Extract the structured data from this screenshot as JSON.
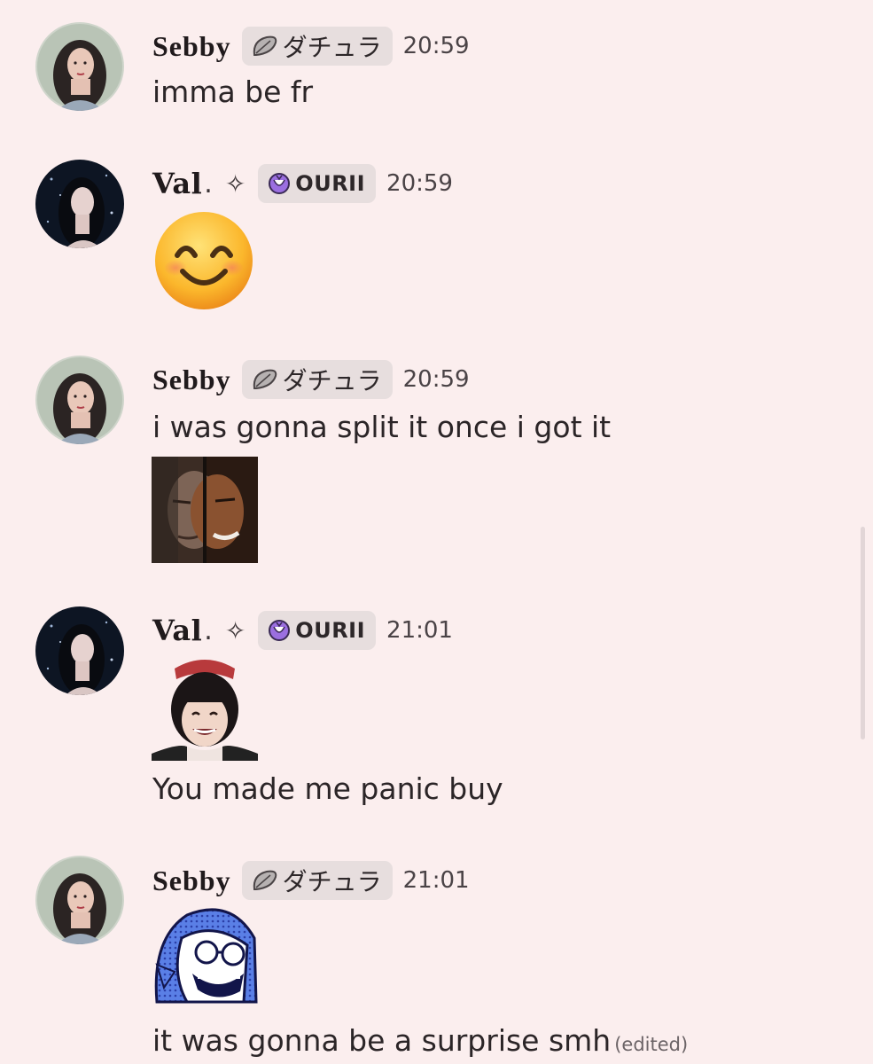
{
  "messages": [
    {
      "user": "Sebby",
      "tag": "ダチュラ",
      "time": "20:59",
      "text": "imma be fr"
    },
    {
      "user": "Val",
      "user_suffix": ".",
      "sparkle": "✧",
      "tag": "OURII",
      "time": "20:59",
      "emoji_icon": "smiling-face-emoji"
    },
    {
      "user": "Sebby",
      "tag": "ダチュラ",
      "time": "20:59",
      "text": "i was gonna split it once i got it",
      "attachment_icon": "split-face-sticker"
    },
    {
      "user": "Val",
      "user_suffix": ".",
      "sparkle": "✧",
      "tag": "OURII",
      "time": "21:01",
      "text": "You made me panic buy",
      "attachment_icon": "laughing-girl-sticker"
    },
    {
      "user": "Sebby",
      "tag": "ダチュラ",
      "time": "21:01",
      "text": "it was gonna be a surprise smh",
      "edited": "(edited)",
      "attachment_icon": "blue-hair-cartoon-sticker"
    }
  ],
  "colors": {
    "background": "#fbeeee",
    "tag_background": "#e7dede",
    "tag_icon_purple": "#9b6fe0"
  }
}
